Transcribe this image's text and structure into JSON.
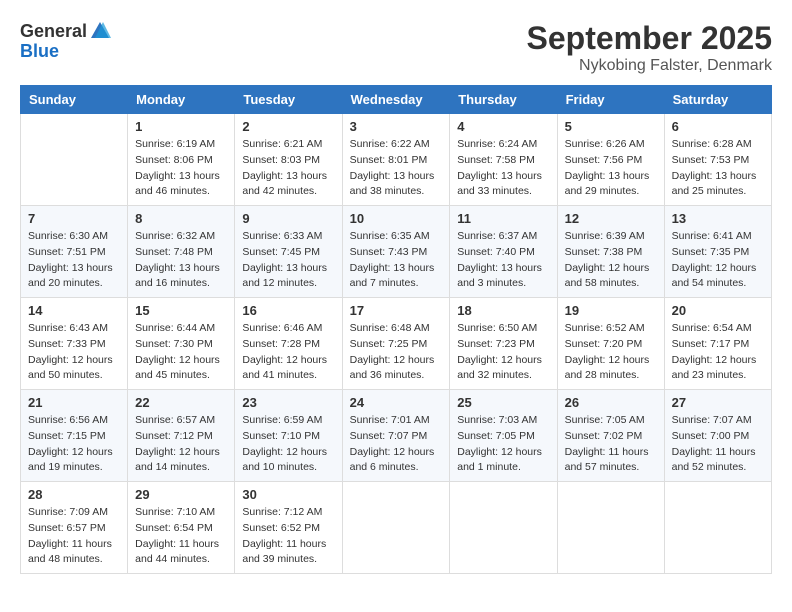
{
  "logo": {
    "general": "General",
    "blue": "Blue"
  },
  "title": "September 2025",
  "location": "Nykobing Falster, Denmark",
  "headers": [
    "Sunday",
    "Monday",
    "Tuesday",
    "Wednesday",
    "Thursday",
    "Friday",
    "Saturday"
  ],
  "weeks": [
    [
      {
        "day": "",
        "info": ""
      },
      {
        "day": "1",
        "info": "Sunrise: 6:19 AM\nSunset: 8:06 PM\nDaylight: 13 hours\nand 46 minutes."
      },
      {
        "day": "2",
        "info": "Sunrise: 6:21 AM\nSunset: 8:03 PM\nDaylight: 13 hours\nand 42 minutes."
      },
      {
        "day": "3",
        "info": "Sunrise: 6:22 AM\nSunset: 8:01 PM\nDaylight: 13 hours\nand 38 minutes."
      },
      {
        "day": "4",
        "info": "Sunrise: 6:24 AM\nSunset: 7:58 PM\nDaylight: 13 hours\nand 33 minutes."
      },
      {
        "day": "5",
        "info": "Sunrise: 6:26 AM\nSunset: 7:56 PM\nDaylight: 13 hours\nand 29 minutes."
      },
      {
        "day": "6",
        "info": "Sunrise: 6:28 AM\nSunset: 7:53 PM\nDaylight: 13 hours\nand 25 minutes."
      }
    ],
    [
      {
        "day": "7",
        "info": "Sunrise: 6:30 AM\nSunset: 7:51 PM\nDaylight: 13 hours\nand 20 minutes."
      },
      {
        "day": "8",
        "info": "Sunrise: 6:32 AM\nSunset: 7:48 PM\nDaylight: 13 hours\nand 16 minutes."
      },
      {
        "day": "9",
        "info": "Sunrise: 6:33 AM\nSunset: 7:45 PM\nDaylight: 13 hours\nand 12 minutes."
      },
      {
        "day": "10",
        "info": "Sunrise: 6:35 AM\nSunset: 7:43 PM\nDaylight: 13 hours\nand 7 minutes."
      },
      {
        "day": "11",
        "info": "Sunrise: 6:37 AM\nSunset: 7:40 PM\nDaylight: 13 hours\nand 3 minutes."
      },
      {
        "day": "12",
        "info": "Sunrise: 6:39 AM\nSunset: 7:38 PM\nDaylight: 12 hours\nand 58 minutes."
      },
      {
        "day": "13",
        "info": "Sunrise: 6:41 AM\nSunset: 7:35 PM\nDaylight: 12 hours\nand 54 minutes."
      }
    ],
    [
      {
        "day": "14",
        "info": "Sunrise: 6:43 AM\nSunset: 7:33 PM\nDaylight: 12 hours\nand 50 minutes."
      },
      {
        "day": "15",
        "info": "Sunrise: 6:44 AM\nSunset: 7:30 PM\nDaylight: 12 hours\nand 45 minutes."
      },
      {
        "day": "16",
        "info": "Sunrise: 6:46 AM\nSunset: 7:28 PM\nDaylight: 12 hours\nand 41 minutes."
      },
      {
        "day": "17",
        "info": "Sunrise: 6:48 AM\nSunset: 7:25 PM\nDaylight: 12 hours\nand 36 minutes."
      },
      {
        "day": "18",
        "info": "Sunrise: 6:50 AM\nSunset: 7:23 PM\nDaylight: 12 hours\nand 32 minutes."
      },
      {
        "day": "19",
        "info": "Sunrise: 6:52 AM\nSunset: 7:20 PM\nDaylight: 12 hours\nand 28 minutes."
      },
      {
        "day": "20",
        "info": "Sunrise: 6:54 AM\nSunset: 7:17 PM\nDaylight: 12 hours\nand 23 minutes."
      }
    ],
    [
      {
        "day": "21",
        "info": "Sunrise: 6:56 AM\nSunset: 7:15 PM\nDaylight: 12 hours\nand 19 minutes."
      },
      {
        "day": "22",
        "info": "Sunrise: 6:57 AM\nSunset: 7:12 PM\nDaylight: 12 hours\nand 14 minutes."
      },
      {
        "day": "23",
        "info": "Sunrise: 6:59 AM\nSunset: 7:10 PM\nDaylight: 12 hours\nand 10 minutes."
      },
      {
        "day": "24",
        "info": "Sunrise: 7:01 AM\nSunset: 7:07 PM\nDaylight: 12 hours\nand 6 minutes."
      },
      {
        "day": "25",
        "info": "Sunrise: 7:03 AM\nSunset: 7:05 PM\nDaylight: 12 hours\nand 1 minute."
      },
      {
        "day": "26",
        "info": "Sunrise: 7:05 AM\nSunset: 7:02 PM\nDaylight: 11 hours\nand 57 minutes."
      },
      {
        "day": "27",
        "info": "Sunrise: 7:07 AM\nSunset: 7:00 PM\nDaylight: 11 hours\nand 52 minutes."
      }
    ],
    [
      {
        "day": "28",
        "info": "Sunrise: 7:09 AM\nSunset: 6:57 PM\nDaylight: 11 hours\nand 48 minutes."
      },
      {
        "day": "29",
        "info": "Sunrise: 7:10 AM\nSunset: 6:54 PM\nDaylight: 11 hours\nand 44 minutes."
      },
      {
        "day": "30",
        "info": "Sunrise: 7:12 AM\nSunset: 6:52 PM\nDaylight: 11 hours\nand 39 minutes."
      },
      {
        "day": "",
        "info": ""
      },
      {
        "day": "",
        "info": ""
      },
      {
        "day": "",
        "info": ""
      },
      {
        "day": "",
        "info": ""
      }
    ]
  ]
}
